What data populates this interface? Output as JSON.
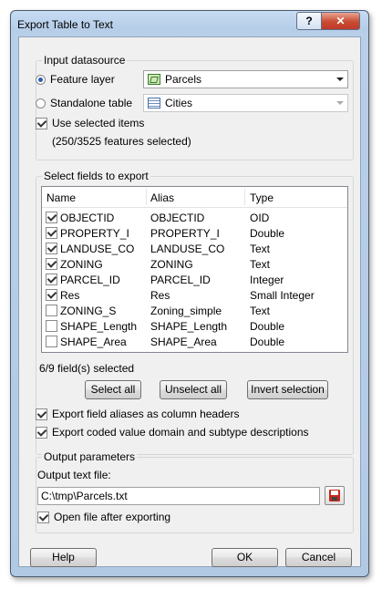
{
  "window": {
    "title": "Export Table to Text",
    "help_button": "?",
    "close_button": "✕"
  },
  "input_datasource": {
    "group_label": "Input datasource",
    "feature_layer": {
      "label": "Feature layer",
      "selected": true,
      "value": "Parcels",
      "icon": "polygon-layer-icon"
    },
    "standalone_table": {
      "label": "Standalone table",
      "selected": false,
      "value": "Cities",
      "icon": "table-icon"
    },
    "use_selected": {
      "label": "Use selected items",
      "checked": true
    },
    "selection_info": "(250/3525 features selected)"
  },
  "fields": {
    "group_label": "Select fields to export",
    "columns": [
      "Name",
      "Alias",
      "Type"
    ],
    "rows": [
      {
        "checked": true,
        "name": "OBJECTID",
        "alias": "OBJECTID",
        "type": "OID"
      },
      {
        "checked": true,
        "name": "PROPERTY_I",
        "alias": "PROPERTY_I",
        "type": "Double"
      },
      {
        "checked": true,
        "name": "LANDUSE_CO",
        "alias": "LANDUSE_CO",
        "type": "Text"
      },
      {
        "checked": true,
        "name": "ZONING",
        "alias": "ZONING",
        "type": "Text"
      },
      {
        "checked": true,
        "name": "PARCEL_ID",
        "alias": "PARCEL_ID",
        "type": "Integer"
      },
      {
        "checked": true,
        "name": "Res",
        "alias": "Res",
        "type": "Small Integer"
      },
      {
        "checked": false,
        "name": "ZONING_S",
        "alias": "Zoning_simple",
        "type": "Text"
      },
      {
        "checked": false,
        "name": "SHAPE_Length",
        "alias": "SHAPE_Length",
        "type": "Double"
      },
      {
        "checked": false,
        "name": "SHAPE_Area",
        "alias": "SHAPE_Area",
        "type": "Double"
      }
    ],
    "selected_count": "6/9 field(s) selected",
    "select_all": "Select all",
    "unselect_all": "Unselect all",
    "invert_selection": "Invert selection",
    "export_aliases": {
      "label": "Export field aliases as column headers",
      "checked": true
    },
    "export_coded": {
      "label": "Export coded value domain and subtype descriptions",
      "checked": true
    }
  },
  "output": {
    "group_label": "Output parameters",
    "file_label": "Output text file:",
    "file_value": "C:\\tmp\\Parcels.txt",
    "open_after": {
      "label": "Open file after exporting",
      "checked": true
    }
  },
  "footer": {
    "help": "Help",
    "ok": "OK",
    "cancel": "Cancel"
  }
}
